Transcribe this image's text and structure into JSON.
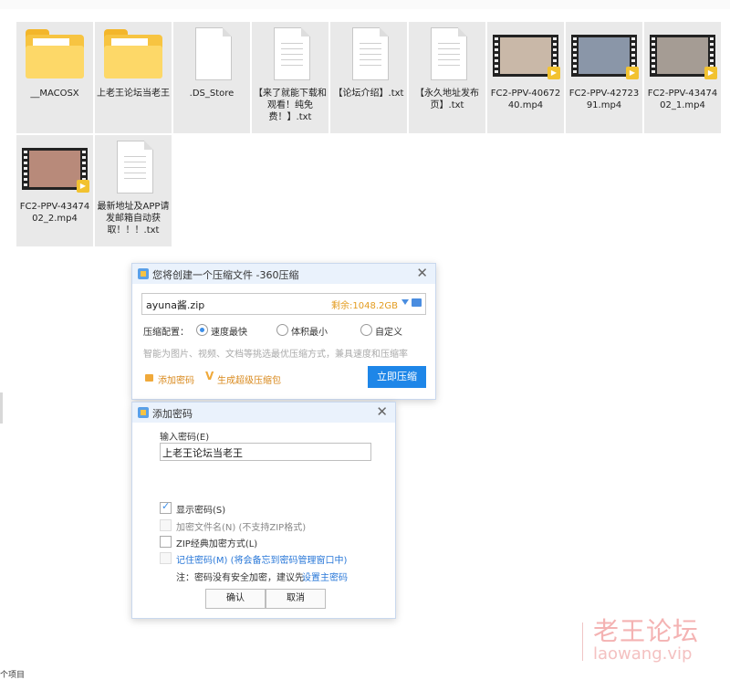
{
  "files": [
    {
      "name": "__MACOSX",
      "kind": "folder"
    },
    {
      "name": "上老王论坛当老王",
      "kind": "folder"
    },
    {
      "name": ".DS_Store",
      "kind": "file"
    },
    {
      "name": "【来了就能下载和观看！纯免费！】.txt",
      "kind": "doc"
    },
    {
      "name": "【论坛介绍】.txt",
      "kind": "doc"
    },
    {
      "name": "【永久地址发布页】.txt",
      "kind": "doc"
    },
    {
      "name": "FC2-PPV-4067240.mp4",
      "kind": "video"
    },
    {
      "name": "FC2-PPV-4272391.mp4",
      "kind": "video"
    },
    {
      "name": "FC2-PPV-4347402_1.mp4",
      "kind": "video"
    },
    {
      "name": "FC2-PPV-4347402_2.mp4",
      "kind": "video"
    },
    {
      "name": "最新地址及APP请发邮箱自动获取！！！.txt",
      "kind": "doc"
    }
  ],
  "compress_dialog": {
    "title": "您将创建一个压缩文件 -360压缩",
    "filename": "ayuna酱.zip",
    "remaining": "剩余:1048.2GB",
    "config_label": "压缩配置：",
    "options": [
      "速度最快",
      "体积最小",
      "自定义"
    ],
    "hint": "智能为图片、视频、文档等挑选最优压缩方式，兼具速度和压缩率",
    "add_password": "添加密码",
    "super_package": "生成超级压缩包",
    "confirm": "立即压缩"
  },
  "password_dialog": {
    "title": "添加密码",
    "input_label": "输入密码(E)",
    "password": "上老王论坛当老王",
    "show_password": "显示密码(S)",
    "encrypt_filenames": "加密文件名(N) (不支持ZIP格式)",
    "zip_classic": "ZIP经典加密方式(L)",
    "remember": "记住密码(M) (将会备忘到密码管理窗口中)",
    "note_prefix": "注：密码没有安全加密，建议先",
    "note_link": "设置主密码",
    "ok": "确认",
    "cancel": "取消"
  },
  "watermark": {
    "cn": "老王论坛",
    "en": "laowang.vip"
  },
  "status": "个项目"
}
